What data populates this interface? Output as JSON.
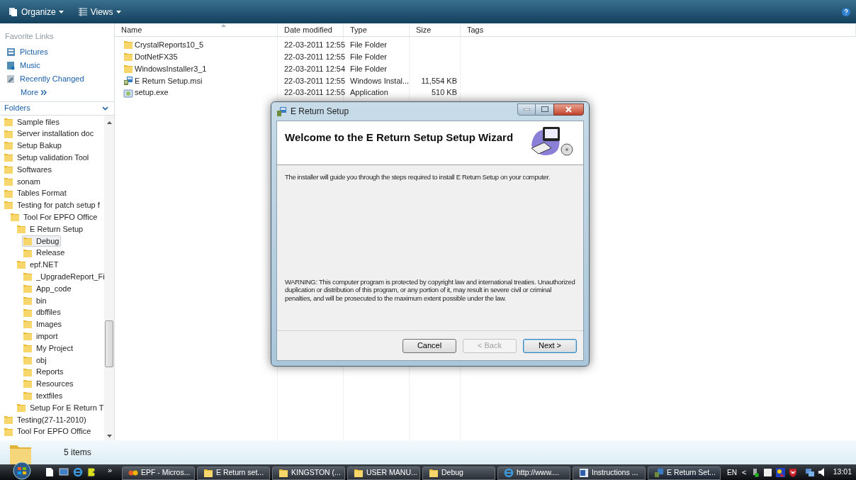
{
  "toolbar": {
    "buttons": [
      {
        "label": "Organize",
        "kind": "organize"
      },
      {
        "label": "Views",
        "kind": "views"
      }
    ]
  },
  "favorite_links": {
    "title": "Favorite Links",
    "items": [
      {
        "label": "Pictures",
        "kind": "pictures"
      },
      {
        "label": "Music",
        "kind": "music"
      },
      {
        "label": "Recently Changed",
        "kind": "recent"
      }
    ],
    "more": "More"
  },
  "folders": {
    "title": "Folders",
    "tree": [
      {
        "label": "Sample files",
        "selected": false
      },
      {
        "label": "Server installation doc",
        "selected": false
      },
      {
        "label": "Setup Bakup",
        "selected": false
      },
      {
        "label": "Setup validation Tool",
        "selected": false
      },
      {
        "label": "Softwares",
        "selected": false
      },
      {
        "label": "sonam",
        "selected": false
      },
      {
        "label": "Tables Format",
        "selected": false
      },
      {
        "label": "Testing for patch setup f",
        "selected": false,
        "children": [
          {
            "label": "Tool For EPFO Office",
            "selected": false,
            "children": [
              {
                "label": "E Return Setup",
                "selected": false,
                "children": [
                  {
                    "label": "Debug",
                    "selected": true
                  },
                  {
                    "label": "Release",
                    "selected": false
                  }
                ]
              },
              {
                "label": "epf.NET",
                "selected": false,
                "children": [
                  {
                    "label": "_UpgradeReport_Fi",
                    "selected": false
                  },
                  {
                    "label": "App_code",
                    "selected": false
                  },
                  {
                    "label": "bin",
                    "selected": false
                  },
                  {
                    "label": "dbffiles",
                    "selected": false
                  },
                  {
                    "label": "Images",
                    "selected": false
                  },
                  {
                    "label": "import",
                    "selected": false
                  },
                  {
                    "label": "My Project",
                    "selected": false
                  },
                  {
                    "label": "obj",
                    "selected": false
                  },
                  {
                    "label": "Reports",
                    "selected": false
                  },
                  {
                    "label": "Resources",
                    "selected": false
                  },
                  {
                    "label": "textfiles",
                    "selected": false
                  }
                ]
              },
              {
                "label": "Setup For E Return T",
                "selected": false
              }
            ]
          }
        ]
      },
      {
        "label": "Testing(27-11-2010)",
        "selected": false
      },
      {
        "label": "Tool For EPFO Office",
        "selected": false
      }
    ]
  },
  "file_list": {
    "columns": [
      "Name",
      "Date modified",
      "Type",
      "Size",
      "Tags"
    ],
    "rows": [
      {
        "kind": "folder",
        "cells": [
          "CrystalReports10_5",
          "22-03-2011 12:55",
          "File Folder",
          ""
        ]
      },
      {
        "kind": "folder",
        "cells": [
          "DotNetFX35",
          "22-03-2011 12:55",
          "File Folder",
          ""
        ]
      },
      {
        "kind": "folder",
        "cells": [
          "WindowsInstaller3_1",
          "22-03-2011 12:54",
          "File Folder",
          ""
        ]
      },
      {
        "kind": "msi",
        "cells": [
          "E Return Setup.msi",
          "22-03-2011 12:55",
          "Windows Instal...",
          "11,554 KB"
        ]
      },
      {
        "kind": "exe",
        "cells": [
          "setup.exe",
          "22-03-2011 12:55",
          "Application",
          "510 KB"
        ]
      }
    ]
  },
  "status_bar": {
    "count": "5 items"
  },
  "dialog": {
    "title": "E Return Setup",
    "heading": "Welcome to the E Return Setup Setup Wizard",
    "intro": "The installer will guide you through the steps required to install E Return Setup on your computer.",
    "warning": "WARNING: This computer program is protected by copyright law and international treaties. Unauthorized duplication or distribution of this program, or any portion of it, may result in severe civil or criminal penalties, and will be prosecuted to the maximum extent possible under the law.",
    "buttons": [
      {
        "label": "Cancel",
        "disabled": false,
        "selected": false
      },
      {
        "label": "< Back",
        "disabled": true,
        "selected": false
      },
      {
        "label": "Next >",
        "disabled": false,
        "selected": true
      }
    ]
  },
  "taskbar": {
    "overflow": "»",
    "buttons": [
      {
        "label": "EPF - Micros...",
        "kind": "app",
        "selected": false
      },
      {
        "label": "E Return set...",
        "kind": "folder",
        "selected": false
      },
      {
        "label": "KINGSTON (...",
        "kind": "folder",
        "selected": false
      },
      {
        "label": "USER MANU...",
        "kind": "folder",
        "selected": false
      },
      {
        "label": "Debug",
        "kind": "folder",
        "selected": false
      },
      {
        "label": "http://www....",
        "kind": "browser",
        "selected": false
      },
      {
        "label": "Instructions ...",
        "kind": "document",
        "selected": false
      },
      {
        "label": "E Return Set...",
        "kind": "installer",
        "selected": true
      }
    ],
    "language": "EN",
    "tray_toggle": "<",
    "clock": "13:01"
  }
}
